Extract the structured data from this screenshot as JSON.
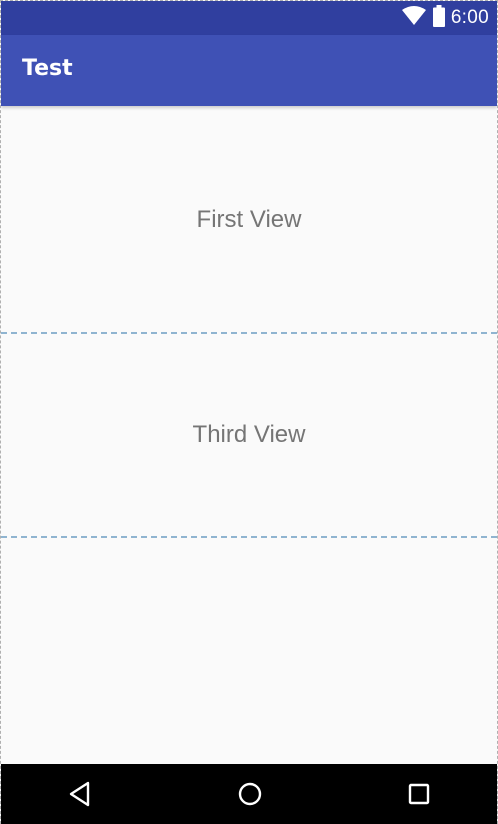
{
  "status_bar": {
    "time": "6:00",
    "icons": [
      "wifi-icon",
      "battery-icon"
    ],
    "color": "#303f9f"
  },
  "app_bar": {
    "title": "Test",
    "color": "#3f51b5"
  },
  "content": {
    "views": [
      {
        "label": "First View"
      },
      {
        "label": "Third View"
      },
      {
        "label": ""
      }
    ]
  },
  "nav_bar": {
    "buttons": [
      "back-icon",
      "home-icon",
      "recents-icon"
    ]
  }
}
